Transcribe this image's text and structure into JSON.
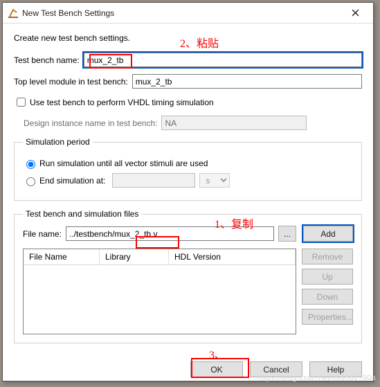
{
  "window": {
    "title": "New Test Bench Settings"
  },
  "instruction": "Create new test bench settings.",
  "fields": {
    "tb_name_label": "Test bench name:",
    "tb_name_value": "mux_2_tb",
    "top_module_label": "Top level module in test bench:",
    "top_module_value": "mux_2_tb",
    "vhdl_check_label": "Use test bench to perform VHDL timing simulation",
    "design_instance_label": "Design instance name in test bench:",
    "design_instance_value": "NA"
  },
  "sim_period": {
    "legend": "Simulation period",
    "opt_all": "Run simulation until all vector stimuli are used",
    "opt_end": "End simulation at:",
    "end_value": "",
    "unit": "s"
  },
  "files": {
    "legend": "Test bench and simulation files",
    "file_name_label": "File name:",
    "file_name_value": "../testbench/mux_2_tb.v",
    "browse": "...",
    "add": "Add",
    "remove": "Remove",
    "up": "Up",
    "down": "Down",
    "properties": "Properties...",
    "cols": {
      "name": "File Name",
      "library": "Library",
      "hdl": "HDL Version"
    }
  },
  "footer": {
    "ok": "OK",
    "cancel": "Cancel",
    "help": "Help"
  },
  "annot": {
    "a1": "1、复制",
    "a2": "2、粘贴",
    "a3": "3、"
  },
  "watermark": "https://blog.csdn.net/li98681790a"
}
